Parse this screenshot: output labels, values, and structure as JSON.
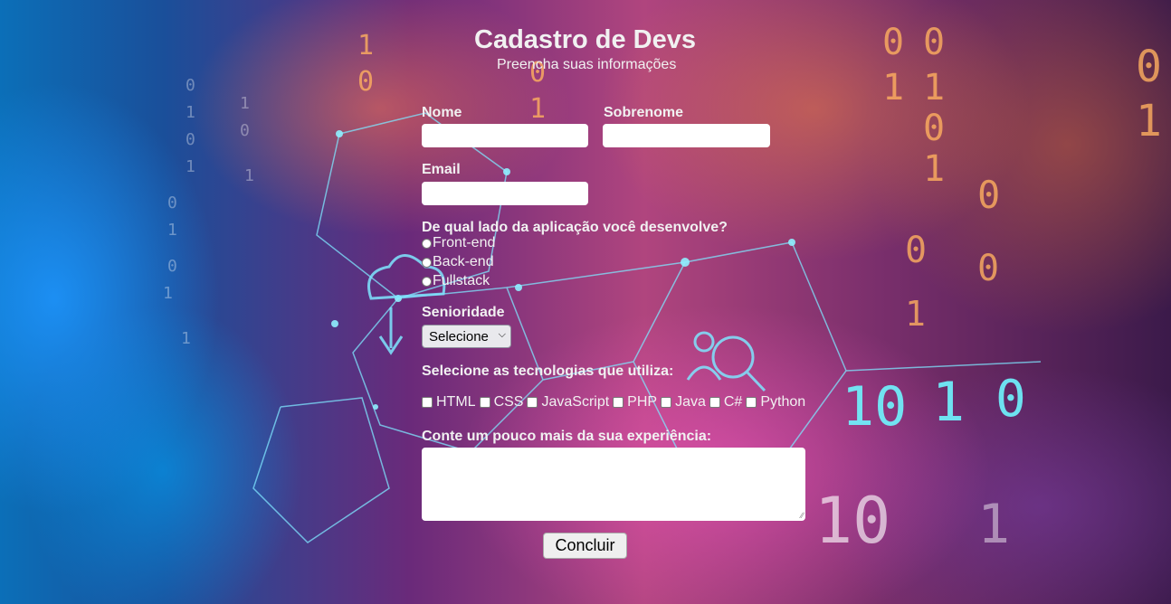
{
  "header": {
    "title": "Cadastro de Devs",
    "subtitle": "Preencha suas informações"
  },
  "form": {
    "first_name": {
      "label": "Nome",
      "value": ""
    },
    "last_name": {
      "label": "Sobrenome",
      "value": ""
    },
    "email": {
      "label": "Email",
      "value": ""
    },
    "side": {
      "label": "De qual lado da aplicação você desenvolve?",
      "options": [
        "Front-end",
        "Back-end",
        "Fullstack"
      ]
    },
    "seniority": {
      "label": "Senioridade",
      "selected": "Selecione"
    },
    "technologies": {
      "label": "Selecione as tecnologias que utiliza:",
      "options": [
        "HTML",
        "CSS",
        "JavaScript",
        "PHP",
        "Java",
        "C#",
        "Python"
      ]
    },
    "experience": {
      "label": "Conte um pouco mais da sua experiência:",
      "value": ""
    },
    "submit_label": "Concluir"
  },
  "colors": {
    "label_text": "#f1f1f1",
    "input_bg": "#ffffff",
    "button_bg": "#efefef"
  }
}
